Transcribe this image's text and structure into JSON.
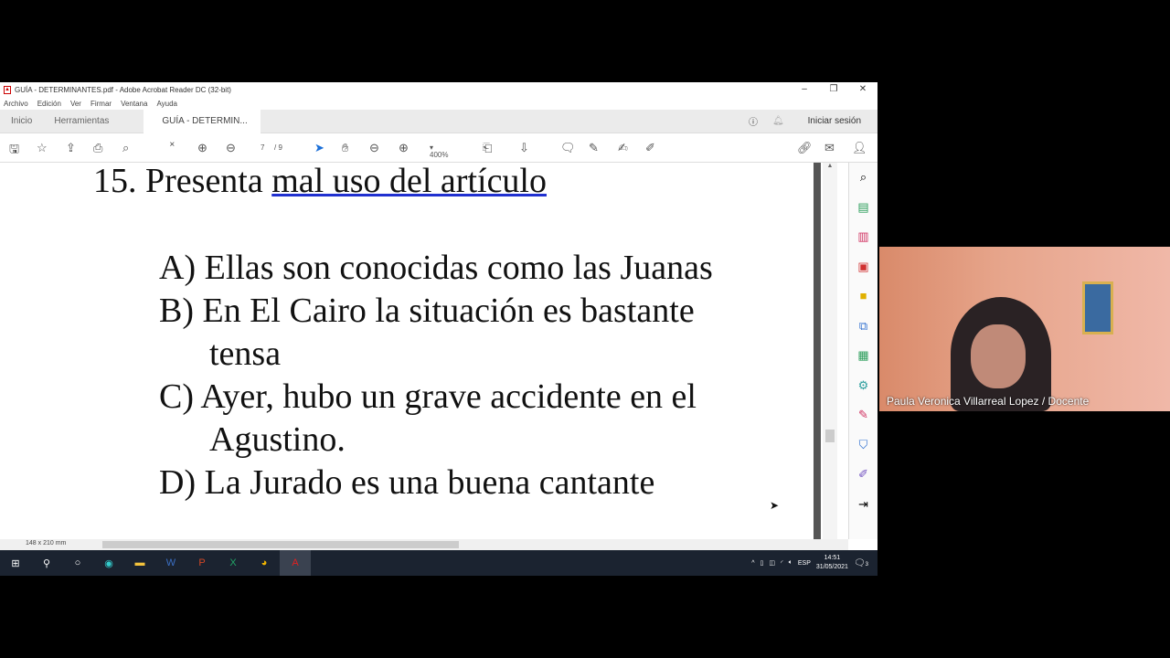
{
  "window": {
    "title": "GUÍA - DETERMINANTES.pdf - Adobe Acrobat Reader DC (32-bit)",
    "controls": [
      "–",
      "❐",
      "✕"
    ]
  },
  "menu": [
    "Archivo",
    "Edición",
    "Ver",
    "Firmar",
    "Ventana",
    "Ayuda"
  ],
  "tabs": {
    "home": "Inicio",
    "tools": "Herramientas",
    "doc": "GUÍA - DETERMIN...",
    "close": "×",
    "signin": "Iniciar sesión"
  },
  "toolbar": {
    "page_current": "7",
    "page_total": "/ 9",
    "zoom": "400%"
  },
  "document": {
    "question": "15. Presenta ",
    "question_underlined": "mal uso del artículo",
    "options": [
      {
        "letter": "A)",
        "lines": [
          "Ellas son conocidas como las Juanas"
        ]
      },
      {
        "letter": "B)",
        "lines": [
          "En El Cairo la situación es bastante",
          "tensa"
        ]
      },
      {
        "letter": "C)",
        "lines": [
          "Ayer, hubo un grave accidente en el",
          "Agustino."
        ]
      },
      {
        "letter": "D)",
        "lines": [
          "La Jurado es una buena cantante"
        ]
      }
    ]
  },
  "status": {
    "page_size": "148 x 210 mm"
  },
  "taskbar": {
    "lang": "ESP",
    "time": "14:51",
    "date": "31/05/2021",
    "notifications": "3"
  },
  "video": {
    "participant": "Paula Veronica Villarreal Lopez / Docente"
  }
}
